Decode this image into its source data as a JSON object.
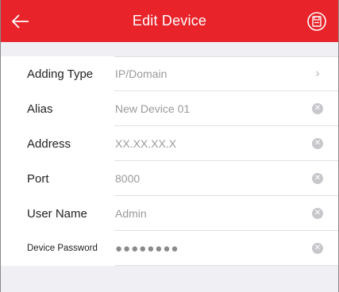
{
  "header": {
    "title": "Edit Device",
    "back_icon": "back-arrow-icon",
    "save_icon": "save-icon",
    "color": "#e8232a"
  },
  "fields": [
    {
      "label": "Adding Type",
      "value": "IP/Domain",
      "trailing": "chevron-right-icon"
    },
    {
      "label": "Alias",
      "value": "New Device 01",
      "trailing": "clear-icon"
    },
    {
      "label": "Address",
      "value": "XX.XX.XX.X",
      "trailing": "clear-icon"
    },
    {
      "label": "Port",
      "value": "8000",
      "trailing": "clear-icon"
    },
    {
      "label": "User Name",
      "value": "Admin",
      "trailing": "clear-icon"
    },
    {
      "label": "Device Password",
      "value": "●●●●●●●●",
      "trailing": "clear-icon"
    }
  ]
}
